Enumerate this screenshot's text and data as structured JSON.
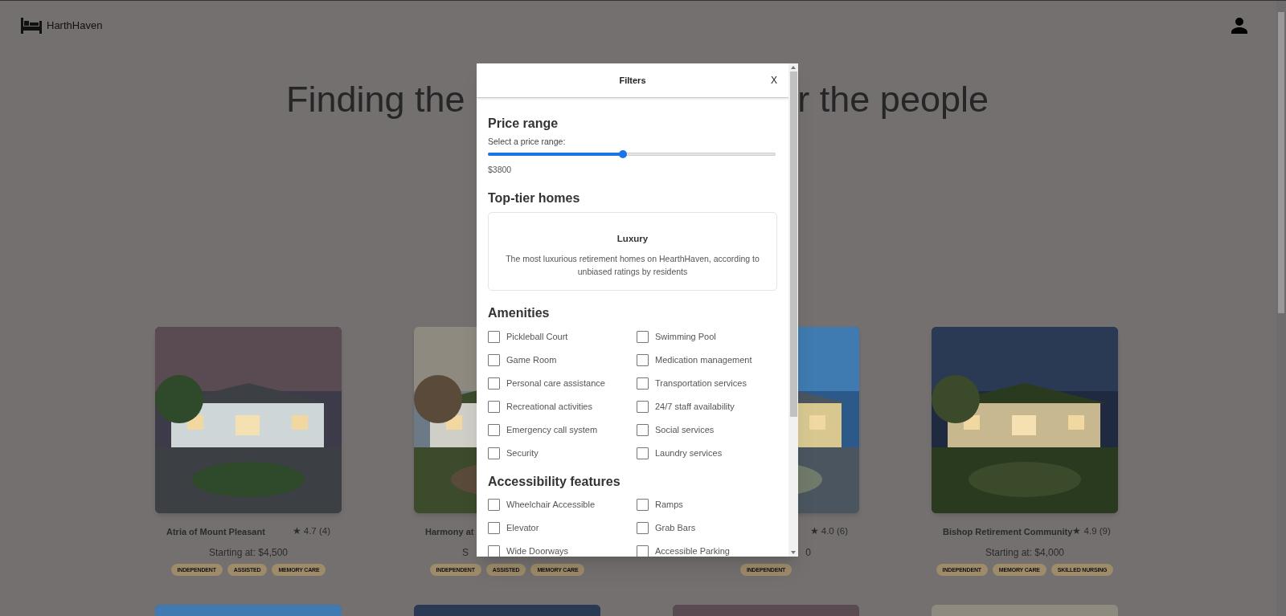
{
  "header": {
    "logo": "HarthHaven"
  },
  "hero": {
    "text_left": "Finding the",
    "text_right": "r the people"
  },
  "cards": [
    {
      "kind": "full",
      "title": "Atria of Mount Pleasant",
      "rating": "★ 4.7 (4)",
      "price_label": "Starting at:",
      "price": "$4,500",
      "tags": [
        "INDEPENDENT",
        "ASSISTED",
        "MEMORY CARE"
      ]
    },
    {
      "kind": "clipped_right",
      "title": "Harmony at",
      "price_label": "S",
      "tags": [
        "INDEPENDENT",
        "ASSISTED",
        "MEMORY CARE"
      ]
    },
    {
      "kind": "clipped_left",
      "rating": "★ 4.0 (6)",
      "price": "0",
      "tags": [
        "INDEPENDENT"
      ]
    },
    {
      "kind": "full",
      "title": "Bishop Retirement Community",
      "rating": "★ 4.9 (9)",
      "price_label": "Starting at:",
      "price": "$4,000",
      "tags": [
        "INDEPENDENT",
        "MEMORY CARE",
        "SKILLED NURSING"
      ]
    }
  ],
  "filters": {
    "title": "Filters",
    "close": "X",
    "price": {
      "heading": "Price range",
      "label": "Select a price range:",
      "level": 0.47,
      "value": "$3800"
    },
    "top_tier": {
      "heading": "Top-tier homes",
      "card_title": "Luxury",
      "card_text": "The most luxurious retirement homes on HearthHaven, according to unbiased ratings by residents"
    },
    "amenities": {
      "heading": "Amenities",
      "items": [
        {
          "label": "Pickleball Court",
          "checked": false
        },
        {
          "label": "Swimming Pool",
          "checked": false
        },
        {
          "label": "Game Room",
          "checked": false
        },
        {
          "label": "Medication management",
          "checked": false
        },
        {
          "label": "Personal care assistance",
          "checked": false
        },
        {
          "label": "Transportation services",
          "checked": false
        },
        {
          "label": "Recreational activities",
          "checked": false
        },
        {
          "label": "24/7 staff availability",
          "checked": false
        },
        {
          "label": "Emergency call system",
          "checked": false
        },
        {
          "label": "Social services",
          "checked": false
        },
        {
          "label": "Security",
          "checked": false
        },
        {
          "label": "Laundry services",
          "checked": false
        }
      ]
    },
    "accessibility": {
      "heading": "Accessibility features",
      "items": [
        {
          "label": "Wheelchair Accessible",
          "checked": false
        },
        {
          "label": "Ramps",
          "checked": false
        },
        {
          "label": "Elevator",
          "checked": false
        },
        {
          "label": "Grab Bars",
          "checked": false
        },
        {
          "label": "Wide Doorways",
          "checked": false
        },
        {
          "label": "Accessible Parking",
          "checked": false
        }
      ]
    }
  }
}
